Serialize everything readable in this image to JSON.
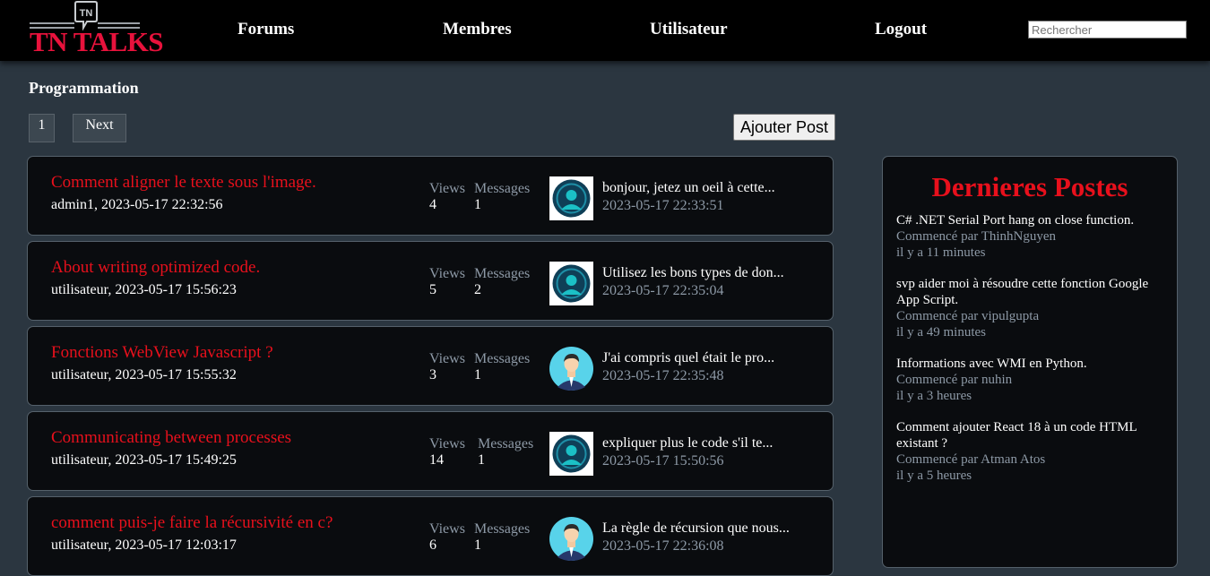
{
  "header": {
    "logo_badge": "TN",
    "logo_text": "TN TALKS",
    "nav": [
      "Forums",
      "Membres",
      "Utilisateur",
      "Logout"
    ],
    "search_placeholder": "Rechercher"
  },
  "page": {
    "title": "Programmation",
    "pager": {
      "current": "1",
      "next": "Next"
    },
    "add_post": "Ajouter Post"
  },
  "stat_labels": {
    "views": "Views",
    "messages": "Messages"
  },
  "topics": [
    {
      "title": "Comment aligner le texte sous l'image.",
      "meta": "admin1, 2023-05-17 22:32:56",
      "views": "4",
      "messages": "1",
      "last_message": "bonjour, jetez un oeil à cette...",
      "last_date": "2023-05-17 22:33:51",
      "avatar": "dark-avatar-icon"
    },
    {
      "title": "About writing optimized code.",
      "meta": "utilisateur, 2023-05-17 15:56:23",
      "views": "5",
      "messages": "2",
      "last_message": "Utilisez les bons types de don...",
      "last_date": "2023-05-17 22:35:04",
      "avatar": "dark-avatar-icon"
    },
    {
      "title": "Fonctions WebView Javascript ?",
      "meta": "utilisateur, 2023-05-17 15:55:32",
      "views": "3",
      "messages": "1",
      "last_message": "J'ai compris quel était le pro...",
      "last_date": "2023-05-17 22:35:48",
      "avatar": "businessman-avatar-icon"
    },
    {
      "title": "Communicating between processes",
      "meta": "utilisateur, 2023-05-17 15:49:25",
      "views": "14",
      "messages": "1",
      "last_message": "expliquer plus le code s'il te...",
      "last_date": "2023-05-17 15:50:56",
      "avatar": "dark-avatar-icon"
    },
    {
      "title": "comment puis-je faire la récursivité en c?",
      "meta": "utilisateur, 2023-05-17 12:03:17",
      "views": "6",
      "messages": "1",
      "last_message": "La règle de récursion que nous...",
      "last_date": "2023-05-17 22:36:08",
      "avatar": "businessman-avatar-icon"
    }
  ],
  "sidebar": {
    "title": "Dernieres Postes",
    "items": [
      {
        "title": "C# .NET Serial Port hang on close function.",
        "author": "Commencé par ThinhNguyen",
        "time": "il y a 11 minutes"
      },
      {
        "title": "svp aider moi à résoudre cette fonction Google App Script.",
        "author": "Commencé par vipulgupta",
        "time": "il y a 49 minutes"
      },
      {
        "title": "Informations avec WMI en Python.",
        "author": "Commencé par nuhin",
        "time": "il y a 3 heures"
      },
      {
        "title": "Comment ajouter React 18 à un code HTML existant ?",
        "author": "Commencé par Atman Atos",
        "time": "il y a 5 heures"
      }
    ]
  },
  "colors": {
    "accent": "#e8101c",
    "muted": "#8d99a6",
    "card": "#0a0c0f",
    "page": "#2b3640"
  }
}
